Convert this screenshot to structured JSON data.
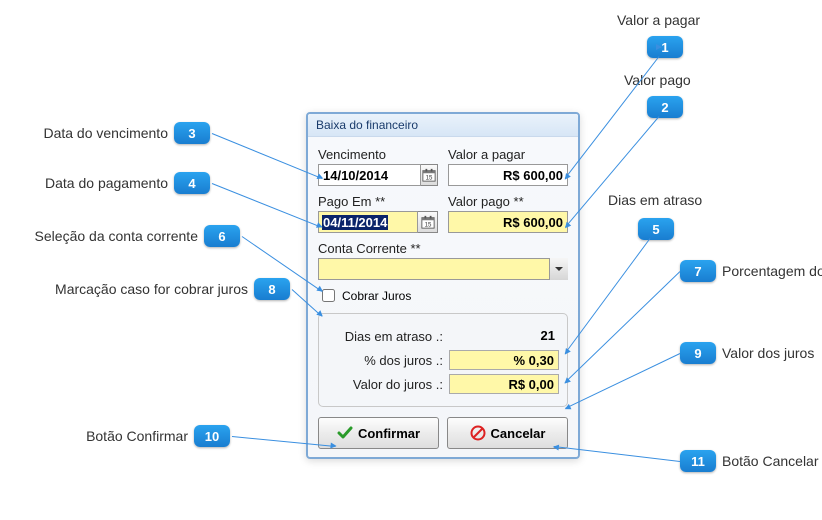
{
  "dialog": {
    "title": "Baixa do financeiro",
    "vencimento": {
      "label": "Vencimento",
      "value": "14/10/2014"
    },
    "valor_pagar": {
      "label": "Valor a pagar",
      "value": "R$ 600,00"
    },
    "pago_em": {
      "label": "Pago Em **",
      "value": "04/11/2014"
    },
    "valor_pago": {
      "label": "Valor pago **",
      "value": "R$ 600,00"
    },
    "conta_corrente": {
      "label": "Conta Corrente **",
      "value": ""
    },
    "cobrar_juros": {
      "label": "Cobrar Juros",
      "checked": false
    },
    "dias_atraso": {
      "label": "Dias em atraso .:",
      "value": "21"
    },
    "pct_juros": {
      "label": "% dos juros .:",
      "value": "% 0,30"
    },
    "valor_juros": {
      "label": "Valor do juros .:",
      "value": "R$ 0,00"
    },
    "buttons": {
      "confirm": "Confirmar",
      "cancel": "Cancelar"
    }
  },
  "callouts": {
    "c1": {
      "num": "1",
      "text": "Valor a pagar"
    },
    "c2": {
      "num": "2",
      "text": "Valor pago"
    },
    "c3": {
      "num": "3",
      "text": "Data do vencimento"
    },
    "c4": {
      "num": "4",
      "text": "Data do pagamento"
    },
    "c5": {
      "num": "5",
      "text": "Dias em atraso"
    },
    "c6": {
      "num": "6",
      "text": "Seleção da conta corrente"
    },
    "c7": {
      "num": "7",
      "text": "Porcentagem dos juros"
    },
    "c8": {
      "num": "8",
      "text": "Marcação caso for cobrar juros"
    },
    "c9": {
      "num": "9",
      "text": "Valor dos juros"
    },
    "c10": {
      "num": "10",
      "text": "Botão Confirmar"
    },
    "c11": {
      "num": "11",
      "text": "Botão Cancelar"
    }
  }
}
